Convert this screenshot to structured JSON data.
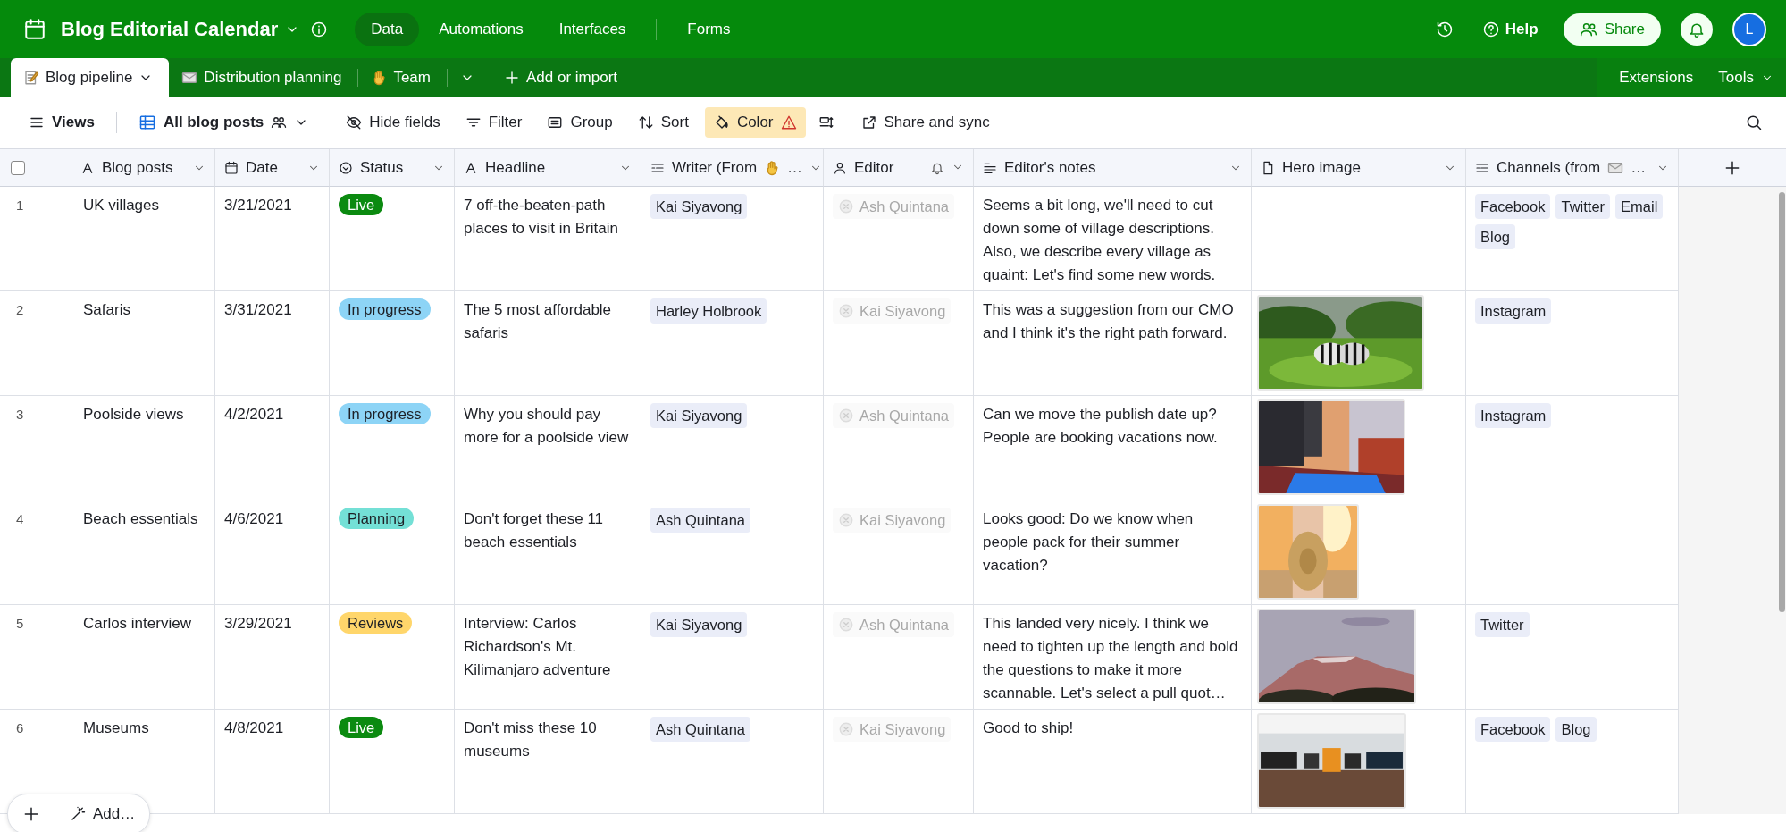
{
  "app_bar": {
    "title": "Blog Editorial Calendar",
    "nav": [
      {
        "label": "Data",
        "selected": true
      },
      {
        "label": "Automations",
        "selected": false
      },
      {
        "label": "Interfaces",
        "selected": false
      },
      {
        "label": "Forms",
        "selected": false
      }
    ],
    "help": "Help",
    "share": "Share",
    "avatar": "L"
  },
  "table_tabs": {
    "tabs": [
      {
        "label": "Blog pipeline",
        "selected": true
      },
      {
        "label": "Distribution planning",
        "selected": false
      },
      {
        "label": "Team",
        "selected": false
      }
    ],
    "add": "Add or import",
    "extensions": "Extensions",
    "tools": "Tools"
  },
  "toolbar": {
    "views": "Views",
    "view_name": "All blog posts",
    "items": [
      {
        "label": "Hide fields",
        "active": false
      },
      {
        "label": "Filter",
        "active": false
      },
      {
        "label": "Group",
        "active": false
      },
      {
        "label": "Sort",
        "active": false
      },
      {
        "label": "Color",
        "active": true
      }
    ],
    "share_sync": "Share and sync"
  },
  "table": {
    "select_all": {
      "checked": false
    },
    "columns": [
      {
        "label": "Blog posts"
      },
      {
        "label": "Date"
      },
      {
        "label": "Status"
      },
      {
        "label": "Headline"
      },
      {
        "label": "Writer (From",
        "suffix": "…"
      },
      {
        "label": "Editor"
      },
      {
        "label": "Editor's notes"
      },
      {
        "label": "Hero image"
      },
      {
        "label": "Channels (from",
        "suffix": "…"
      }
    ],
    "rows": [
      {
        "number": "1",
        "post": "UK villages",
        "date": "3/21/2021",
        "status": {
          "label": "Live",
          "color": "#0b8a10"
        },
        "headline": "7 off-the-beaten-path places to visit in Britain",
        "writer": "Kai Siyavong",
        "editor": "Ash Quintana",
        "notes": "Seems a bit long, we'll need to cut down some of village descriptions. Also, we describe every village as quaint: Let's find some new words.",
        "channels": [
          "Facebook",
          "Twitter",
          "Email",
          "Blog"
        ]
      },
      {
        "number": "2",
        "post": "Safaris",
        "date": "3/31/2021",
        "status": {
          "label": "In progress",
          "color": "#8dd4f6"
        },
        "headline": "The 5 most affordable safaris",
        "writer": "Harley Holbrook",
        "editor": "Kai Siyavong",
        "notes": "This was a suggestion from our CMO and I think it's the right path forward.",
        "hero_image": {
          "kind": "picture"
        },
        "channels": [
          "Instagram"
        ]
      },
      {
        "number": "3",
        "post": "Poolside views",
        "date": "4/2/2021",
        "status": {
          "label": "In progress",
          "color": "#8dd4f6"
        },
        "headline": "Why you should pay more for a poolside view",
        "writer": "Kai Siyavong",
        "editor": "Ash Quintana",
        "notes": "Can we move the publish date up? People are booking vacations now.",
        "hero_image": {
          "kind": "picture"
        },
        "channels": [
          "Instagram"
        ]
      },
      {
        "number": "4",
        "post": "Beach essentials",
        "date": "4/6/2021",
        "status": {
          "label": "Planning",
          "color": "#74e0d6"
        },
        "headline": "Don't forget these 11 beach essentials",
        "writer": "Ash Quintana",
        "editor": "Kai Siyavong",
        "notes": "Looks good: Do we know when people pack for their summer vacation?",
        "hero_image": {
          "kind": "picture"
        },
        "channels": []
      },
      {
        "number": "5",
        "post": "Carlos interview",
        "date": "3/29/2021",
        "status": {
          "label": "Reviews",
          "color": "#ffd66b"
        },
        "headline": "Interview: Carlos Richardson's Mt. Kilimanjaro adventure",
        "writer": "Kai Siyavong",
        "editor": "Ash Quintana",
        "notes": "This landed very nicely. I think we need to tighten up the length and bold the questions to make it more scannable. Let's select a pull quot…",
        "hero_image": {
          "kind": "picture"
        },
        "channels": [
          "Twitter"
        ]
      },
      {
        "number": "6",
        "post": "Museums",
        "date": "4/8/2021",
        "status": {
          "label": "Live",
          "color": "#0b8a10"
        },
        "headline": "Don't miss these 10 museums",
        "writer": "Ash Quintana",
        "editor": "Kai Siyavong",
        "notes": "Good to ship!",
        "hero_image": {
          "kind": "picture"
        },
        "channels": [
          "Facebook",
          "Blog"
        ]
      }
    ]
  },
  "add_bar": {
    "add": "Add…"
  }
}
